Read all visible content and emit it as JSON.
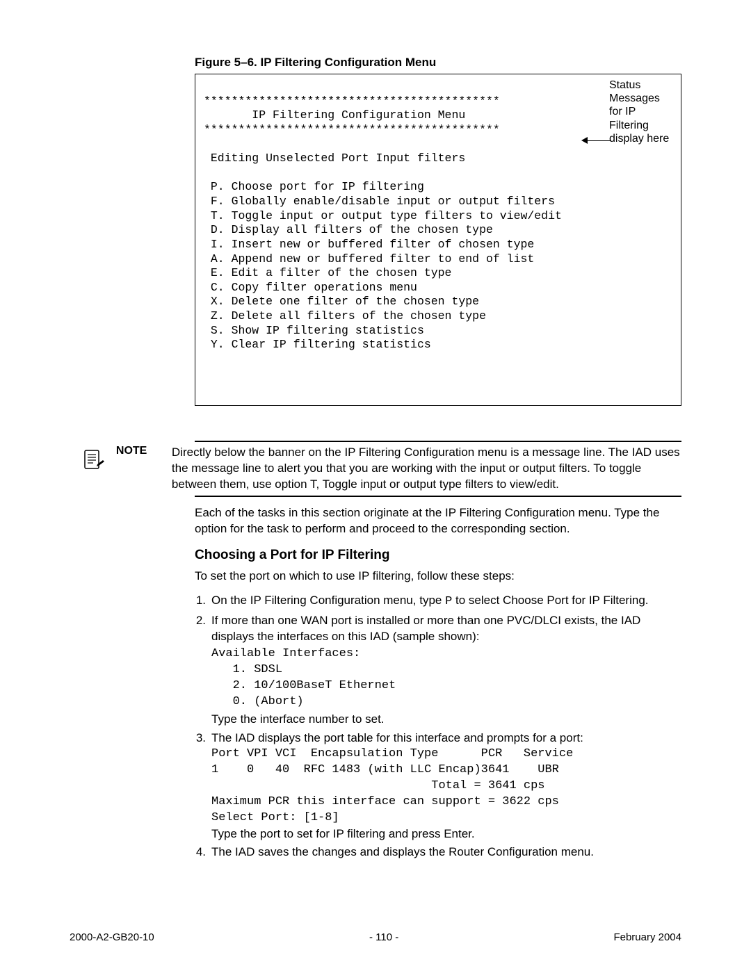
{
  "figure": {
    "caption": "Figure 5–6.  IP Filtering Configuration Menu",
    "annotation": "Status Messages for IP Filtering display here",
    "term": {
      "rule1": "*******************************************",
      "title": "       IP Filtering Configuration Menu",
      "rule2": "*******************************************",
      "blank": "",
      "status": " Editing Unselected Port Input filters",
      "opt_P": " P. Choose port for IP filtering",
      "opt_F": " F. Globally enable/disable input or output filters",
      "opt_T": " T. Toggle input or output type filters to view/edit",
      "opt_D": " D. Display all filters of the chosen type",
      "opt_I": " I. Insert new or buffered filter of chosen type",
      "opt_A": " A. Append new or buffered filter to end of list",
      "opt_E": " E. Edit a filter of the chosen type",
      "opt_C": " C. Copy filter operations menu",
      "opt_X": " X. Delete one filter of the chosen type",
      "opt_Z": " Z. Delete all filters of the chosen type",
      "opt_S": " S. Show IP filtering statistics",
      "opt_Y": " Y. Clear IP filtering statistics"
    }
  },
  "note": {
    "label": "NOTE",
    "body": "Directly below the banner on the IP Filtering Configuration menu is a message line. The IAD uses the message line to alert you that you are working with the input or output filters. To toggle between them, use option T, Toggle input or output type filters to view/edit."
  },
  "intro": "Each of the tasks in this section originate at the IP Filtering Configuration menu. Type the option for the task to perform and proceed to the corresponding section.",
  "section": {
    "heading": "Choosing a Port for IP Filtering",
    "lead": "To set the port on which to use IP filtering, follow these steps:"
  },
  "steps": {
    "s1a": "On the IP Filtering Configuration menu, type ",
    "s1_key": "P",
    "s1b": " to select Choose Port for IP Filtering.",
    "s2a": "If more than one WAN port is installed or more than one PVC/DLCI exists, the IAD displays the interfaces on this IAD (sample shown):",
    "s2_code": {
      "l1": "Available Interfaces:",
      "l2": "   1. SDSL",
      "l3": "   2. 10/100BaseT Ethernet",
      "l4": "   0. (Abort)"
    },
    "s2_after": "Type the interface number to set.",
    "s3a": "The IAD displays the port table for this interface and prompts for a port:",
    "s3_table": {
      "hdr": "Port VPI VCI  Encapsulation Type      PCR   Service",
      "row": "1    0   40  RFC 1483 (with LLC Encap)3641    UBR",
      "tot": "                               Total = 3641 cps",
      "max": "Maximum PCR this interface can support = 3622 cps",
      "sel": "Select Port: [1-8]"
    },
    "s3_after": "Type the port to set for IP filtering and press Enter.",
    "s4": "The IAD saves the changes and displays the Router Configuration menu."
  },
  "footer": {
    "left": "2000-A2-GB20-10",
    "center": "- 110 -",
    "right": "February 2004"
  },
  "nums": {
    "n1": "1.",
    "n2": "2.",
    "n3": "3.",
    "n4": "4."
  }
}
